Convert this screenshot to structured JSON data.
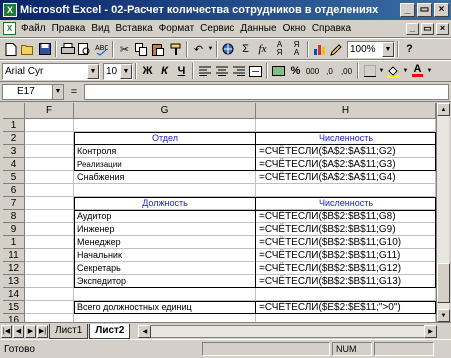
{
  "window": {
    "title": "Microsoft Excel - 02-Расчет количества сотрудников в отделениях",
    "app_icon": "X",
    "minimize_icon": "_",
    "restore_icon": "▭",
    "close_icon": "×"
  },
  "menu": {
    "items": [
      "Файл",
      "Правка",
      "Вид",
      "Вставка",
      "Формат",
      "Сервис",
      "Данные",
      "Окно",
      "Справка"
    ],
    "doc_min_icon": "_",
    "doc_restore_icon": "▭",
    "doc_close_icon": "×"
  },
  "toolbar_standard": {
    "zoom": "100%",
    "sigma": "Σ",
    "fx": "fx",
    "help": "?"
  },
  "toolbar_format": {
    "font_name": "Arial Cyr",
    "font_size": "10",
    "bold": "Ж",
    "italic": "К",
    "underline": "Ч",
    "percent": "%",
    "thousands": "000",
    "inc_dec": ",0",
    "dec_dec": ",00",
    "font_color_letter": "A"
  },
  "formula_bar": {
    "cell_ref": "E17",
    "equals": "=",
    "value": ""
  },
  "grid": {
    "col_headers": [
      "F",
      "G",
      "H"
    ],
    "rows": [
      "1",
      "2",
      "3",
      "4",
      "5",
      "6",
      "7",
      "8",
      "9",
      "1",
      "11",
      "12",
      "13",
      "14",
      "15",
      "16"
    ],
    "cells": {
      "g2": "Отдел",
      "h2": "Численность",
      "g3": "Контроля",
      "h3": "=СЧЁТЕСЛИ($A$2:$A$11;G2)",
      "g4": "Реализации",
      "h4": "=СЧЁТЕСЛИ($A$2:$A$11;G3)",
      "g5": "Снабжения",
      "h5": "=СЧЁТЕСЛИ($A$2:$A$11;G4)",
      "g7": "Должность",
      "h7": "Численность",
      "g8": "Аудитор",
      "h8": "=СЧЁТЕСЛИ($B$2:$B$11;G8)",
      "g9": "Инженер",
      "h9": "=СЧЁТЕСЛИ($B$2:$B$11;G9)",
      "g10": "Менеджер",
      "h10": "=СЧЁТЕСЛИ($B$2:$B$11;G10)",
      "g11": "Начальник",
      "h11": "=СЧЁТЕСЛИ($B$2:$B$11;G11)",
      "g12": "Секретарь",
      "h12": "=СЧЁТЕСЛИ($B$2:$B$11;G12)",
      "g13": "Экспедитор",
      "h13": "=СЧЁТЕСЛИ($B$2:$B$11;G13)",
      "g15": "Всего должностных единиц",
      "h15": "=СЧЁТЕСЛИ($E$2:$E$11;\">0\")"
    }
  },
  "sheets": {
    "tabs": [
      "Лист1",
      "Лист2"
    ],
    "active": "Лист2"
  },
  "status": {
    "text": "Готово",
    "num": "NUM"
  }
}
